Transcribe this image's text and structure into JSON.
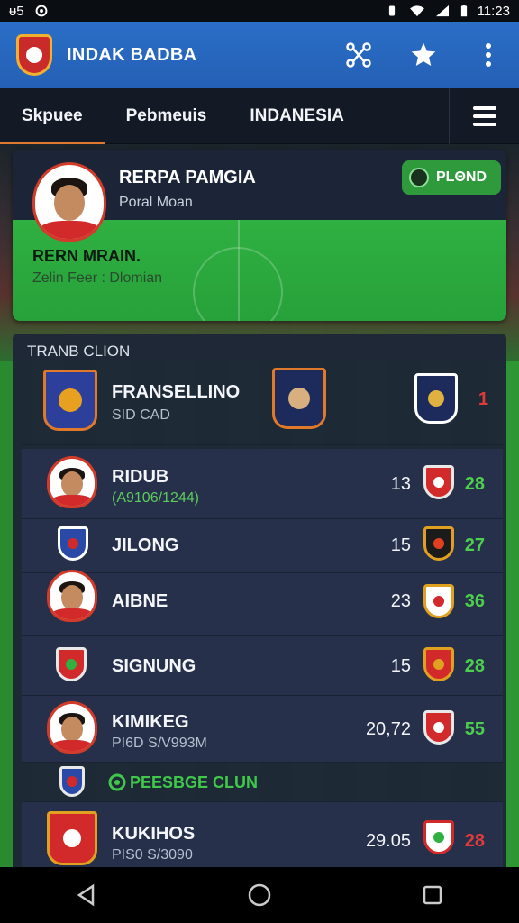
{
  "status_bar": {
    "left_a": "ᵾ5",
    "time": "11:23"
  },
  "app": {
    "title": "INDAK BADBA"
  },
  "tabs": [
    {
      "label": "Skpuee",
      "active": true
    },
    {
      "label": "Pebmeuis",
      "active": false
    },
    {
      "label": "INDAΝESIA",
      "active": false
    }
  ],
  "featured": {
    "name": "RERPA PAMGIA",
    "subtitle": "Poral Moan",
    "badge": "PLΘND",
    "name2": "RERN MRAIN.",
    "detail": "Zelin Feer : Dlomian"
  },
  "panel": {
    "title": "TRANB CLION",
    "header_row": {
      "name": "FRANSELLINO",
      "sub": "SID CAD",
      "score": "1"
    },
    "rows": [
      {
        "name": "RIDUB",
        "sub": "(A9106/1244)",
        "num": "13",
        "score": "28"
      },
      {
        "name": "JILONG",
        "sub": "",
        "num": "15",
        "score": "27"
      },
      {
        "name": "AIBNE",
        "sub": "",
        "num": "23",
        "score": "36"
      },
      {
        "name": "SIGNUNG",
        "sub": "",
        "num": "15",
        "score": "28"
      },
      {
        "name": "KIMIKEG",
        "sub": "PI6D S/V993M",
        "num": "20,72",
        "score": "55"
      }
    ],
    "section_label": "PEESBGE CLUN",
    "last_row": {
      "name": "KUKIHOS",
      "sub": "PIS0 S/3090",
      "num": "29.05",
      "score": "28"
    }
  },
  "colors": {
    "app_bar": "#2b6ec7",
    "accent_tab": "#e07830",
    "green": "#33c43f",
    "red": "#e23a3a"
  }
}
